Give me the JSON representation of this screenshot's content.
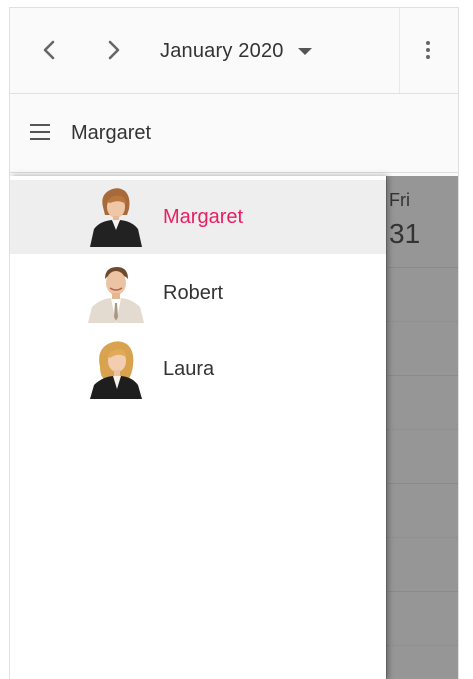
{
  "toolbar": {
    "prev_icon": "chevron-left-icon",
    "next_icon": "chevron-right-icon",
    "date_range": "January 2020",
    "more_icon": "more-vertical-icon"
  },
  "resource_header": {
    "menu_icon": "menu-icon",
    "title": "Margaret"
  },
  "resources": [
    {
      "name": "Margaret",
      "selected": true
    },
    {
      "name": "Robert",
      "selected": false
    },
    {
      "name": "Laura",
      "selected": false
    }
  ],
  "calendar": {
    "day_name": "Fri",
    "day_number": "31"
  },
  "colors": {
    "accent": "#e91e63",
    "selected_bg": "#eeeeee",
    "overlay": "#969696"
  }
}
